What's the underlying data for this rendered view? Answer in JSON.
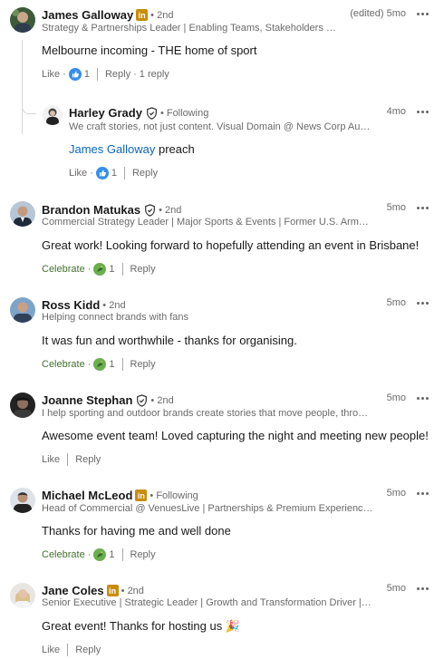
{
  "comments": [
    {
      "name": "James Galloway",
      "badge": "in",
      "degree": "• 2nd",
      "headline": "Strategy & Partnerships Leader | Enabling Teams, Stakeholders & C...",
      "time": "(edited) 5mo",
      "text": "Melbourne incoming - THE home of sport",
      "actions": {
        "react_label": "Like",
        "react_type": "like",
        "count": "1",
        "reply": "Reply",
        "replies": "1 reply"
      }
    },
    {
      "name": "Harley Grady",
      "badge": "verified",
      "degree": "• Following",
      "headline": "We craft stories, not just content. Visual Domain @ News Corp Austr...",
      "time": "4mo",
      "mention": "James Galloway",
      "text": " preach",
      "actions": {
        "react_label": "Like",
        "react_type": "like",
        "count": "1",
        "reply": "Reply"
      }
    },
    {
      "name": "Brandon Matukas",
      "badge": "verified",
      "degree": "• 2nd",
      "headline": "Commercial Strategy Leader | Major Sports & Events | Former U.S. Army Off...",
      "time": "5mo",
      "text": "Great work! Looking forward to hopefully attending an event in Brisbane!",
      "actions": {
        "react_label": "Celebrate",
        "react_type": "celebrate",
        "count": "1",
        "reply": "Reply"
      }
    },
    {
      "name": "Ross Kidd",
      "badge": "",
      "degree": "• 2nd",
      "headline": "Helping connect brands with fans",
      "time": "5mo",
      "text": "It was fun and worthwhile - thanks for organising.",
      "actions": {
        "react_label": "Celebrate",
        "react_type": "celebrate",
        "count": "1",
        "reply": "Reply"
      }
    },
    {
      "name": "Joanne Stephan",
      "badge": "verified",
      "degree": "• 2nd",
      "headline": "I help sporting and outdoor brands create stories that move people, throug...",
      "time": "5mo",
      "text": "Awesome event team! Loved capturing the night and meeting new people!",
      "actions": {
        "react_label": "Like",
        "react_type": "",
        "count": "",
        "reply": "Reply"
      }
    },
    {
      "name": "Michael McLeod",
      "badge": "in",
      "degree": "• Following",
      "headline": "Head of Commercial @ VenuesLive | Partnerships & Premium Experiences",
      "time": "5mo",
      "text": "Thanks for having me and well done",
      "actions": {
        "react_label": "Celebrate",
        "react_type": "celebrate",
        "count": "1",
        "reply": "Reply"
      }
    },
    {
      "name": "Jane Coles",
      "badge": "in",
      "degree": "• 2nd",
      "headline": "Senior Executive | Strategic Leader | Growth and Transformation Driver | Dig...",
      "time": "5mo",
      "text": "Great event! Thanks for hosting us 🎉",
      "actions": {
        "react_label": "Like",
        "react_type": "",
        "count": "",
        "reply": "Reply"
      }
    }
  ],
  "colors": {
    "link_blue": "#0a66c2",
    "celebrate_green": "#44712e",
    "in_badge_gold": "#c98d0a",
    "muted_text": "rgba(0,0,0,0.6)"
  },
  "icons": {
    "like": "thumbs-up-icon",
    "celebrate": "celebrate-icon",
    "verified": "verified-shield-icon",
    "premium": "linkedin-premium-icon",
    "more": "more-options-icon"
  }
}
